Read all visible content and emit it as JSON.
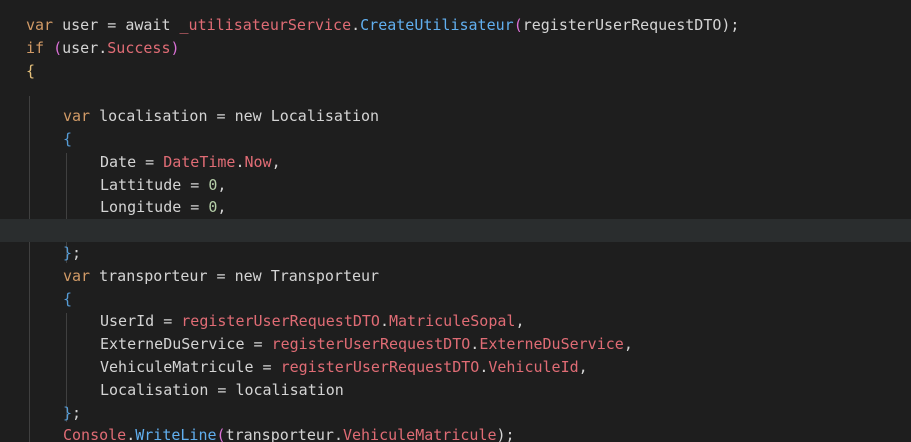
{
  "editor": {
    "lines": [
      [
        {
          "t": "var",
          "c": "kw"
        },
        {
          "t": " user = await ",
          "c": "plain"
        },
        {
          "t": "_utilisateurService",
          "c": "field"
        },
        {
          "t": ".",
          "c": "plain"
        },
        {
          "t": "CreateUtilisateur",
          "c": "method"
        },
        {
          "t": "(",
          "c": "paren"
        },
        {
          "t": "registerUserRequestDTO",
          "c": "plain"
        },
        {
          "t": ");",
          "c": "plain"
        }
      ],
      [
        {
          "t": "if",
          "c": "kw"
        },
        {
          "t": " (",
          "c": "paren"
        },
        {
          "t": "user.",
          "c": "plain"
        },
        {
          "t": "Success",
          "c": "field"
        },
        {
          "t": ")",
          "c": "paren"
        }
      ],
      [
        {
          "t": "{",
          "c": "yellow"
        }
      ],
      [],
      [
        {
          "t": "var",
          "c": "kw"
        },
        {
          "t": " localisation = new Localisation",
          "c": "plain"
        }
      ],
      [
        {
          "t": "{",
          "c": "brace"
        }
      ],
      [
        {
          "t": "Date = ",
          "c": "plain"
        },
        {
          "t": "DateTime",
          "c": "field"
        },
        {
          "t": ".",
          "c": "plain"
        },
        {
          "t": "Now",
          "c": "field"
        },
        {
          "t": ",",
          "c": "plain"
        }
      ],
      [
        {
          "t": "Lattitude = ",
          "c": "plain"
        },
        {
          "t": "0",
          "c": "num"
        },
        {
          "t": ",",
          "c": "plain"
        }
      ],
      [
        {
          "t": "Longitude = ",
          "c": "plain"
        },
        {
          "t": "0",
          "c": "num"
        },
        {
          "t": ",",
          "c": "plain"
        }
      ],
      [],
      [
        {
          "t": "}",
          "c": "brace"
        },
        {
          "t": ";",
          "c": "plain"
        }
      ],
      [
        {
          "t": "var",
          "c": "kw"
        },
        {
          "t": " transporteur = new Transporteur",
          "c": "plain"
        }
      ],
      [
        {
          "t": "{",
          "c": "brace"
        }
      ],
      [
        {
          "t": "UserId = ",
          "c": "plain"
        },
        {
          "t": "registerUserRequestDTO",
          "c": "field"
        },
        {
          "t": ".",
          "c": "plain"
        },
        {
          "t": "MatriculeSopal",
          "c": "field"
        },
        {
          "t": ",",
          "c": "plain"
        }
      ],
      [
        {
          "t": "ExterneDuService = ",
          "c": "plain"
        },
        {
          "t": "registerUserRequestDTO",
          "c": "field"
        },
        {
          "t": ".",
          "c": "plain"
        },
        {
          "t": "ExterneDuService",
          "c": "field"
        },
        {
          "t": ",",
          "c": "plain"
        }
      ],
      [
        {
          "t": "VehiculeMatricule = ",
          "c": "plain"
        },
        {
          "t": "registerUserRequestDTO",
          "c": "field"
        },
        {
          "t": ".",
          "c": "plain"
        },
        {
          "t": "VehiculeId",
          "c": "field"
        },
        {
          "t": ",",
          "c": "plain"
        }
      ],
      [
        {
          "t": "Localisation = localisation",
          "c": "plain"
        }
      ],
      [
        {
          "t": "}",
          "c": "brace"
        },
        {
          "t": ";",
          "c": "plain"
        }
      ],
      [
        {
          "t": "Console",
          "c": "field"
        },
        {
          "t": ".",
          "c": "plain"
        },
        {
          "t": "WriteLine",
          "c": "method"
        },
        {
          "t": "(",
          "c": "paren"
        },
        {
          "t": "transporteur",
          "c": "plain"
        },
        {
          "t": ".",
          "c": "plain"
        },
        {
          "t": "VehiculeMatricule",
          "c": "field"
        },
        {
          "t": ");",
          "c": "plain"
        }
      ]
    ],
    "indents": [
      0,
      0,
      0,
      0,
      1,
      1,
      2,
      2,
      2,
      2,
      1,
      1,
      1,
      2,
      2,
      2,
      2,
      1,
      1
    ],
    "current_line": 9
  }
}
